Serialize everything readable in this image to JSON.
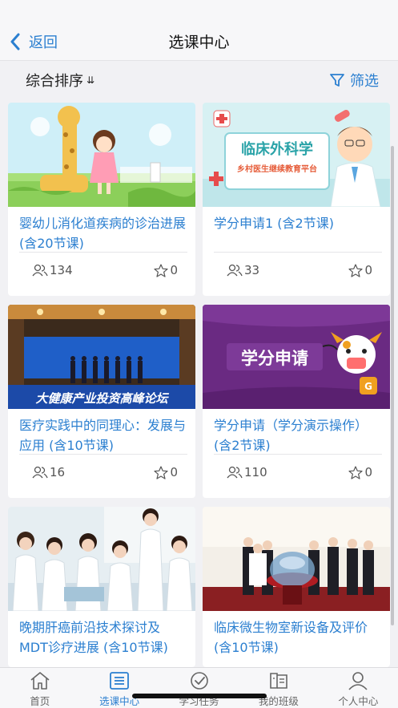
{
  "navbar": {
    "back_label": "返回",
    "title": "选课中心"
  },
  "sortbar": {
    "sort_label": "综合排序",
    "sort_icon": "⇊",
    "filter_label": "筛选"
  },
  "courses": [
    {
      "title": "婴幼儿消化道疾病的诊治进展 (含20节课)",
      "learners": "134",
      "favorites": "0"
    },
    {
      "title": "学分申请1 (含2节课)",
      "learners": "33",
      "favorites": "0",
      "banner_text": "临床外科学",
      "banner_subtext": "乡村医生继续教育平台"
    },
    {
      "title": "医疗实践中的同理心：发展与应用 (含10节课)",
      "learners": "16",
      "favorites": "0",
      "banner_text": "大健康产业投资高峰论坛"
    },
    {
      "title": "学分申请（学分演示操作）(含2节课)",
      "learners": "110",
      "favorites": "0",
      "banner_text": "学分申请"
    },
    {
      "title": "晚期肝癌前沿技术探讨及MDT诊疗进展 (含10节课)",
      "learners": "",
      "favorites": ""
    },
    {
      "title": "临床微生物室新设备及评价 (含10节课)",
      "learners": "",
      "favorites": ""
    }
  ],
  "tabbar": {
    "tabs": [
      {
        "label": "首页",
        "icon": "home-icon"
      },
      {
        "label": "选课中心",
        "icon": "course-list-icon"
      },
      {
        "label": "学习任务",
        "icon": "check-circle-icon"
      },
      {
        "label": "我的班级",
        "icon": "class-book-icon"
      },
      {
        "label": "个人中心",
        "icon": "person-icon"
      }
    ],
    "active_index": 1
  },
  "colors": {
    "accent": "#2b7fd0",
    "background": "#f1f1f4",
    "card": "#ffffff"
  }
}
